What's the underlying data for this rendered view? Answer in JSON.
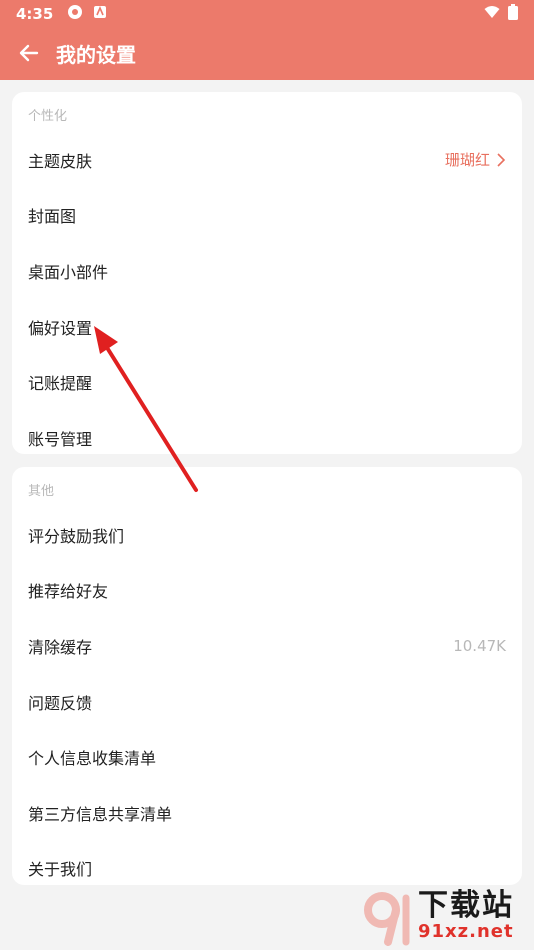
{
  "status_bar": {
    "time": "4:35"
  },
  "header": {
    "title": "我的设置"
  },
  "sections": [
    {
      "title": "个性化",
      "items": [
        {
          "label": "主题皮肤",
          "value": "珊瑚红"
        },
        {
          "label": "封面图"
        },
        {
          "label": "桌面小部件"
        },
        {
          "label": "偏好设置"
        },
        {
          "label": "记账提醒"
        },
        {
          "label": "账号管理"
        }
      ]
    },
    {
      "title": "其他",
      "items": [
        {
          "label": "评分鼓励我们"
        },
        {
          "label": "推荐给好友"
        },
        {
          "label": "清除缓存",
          "value": "10.47K"
        },
        {
          "label": "问题反馈"
        },
        {
          "label": "个人信息收集清单"
        },
        {
          "label": "第三方信息共享清单"
        },
        {
          "label": "关于我们"
        }
      ]
    }
  ],
  "watermark": {
    "main": "下载站",
    "sub": "91xz.net"
  },
  "colors": {
    "header": "#ec7a6b",
    "accent": "#e8705f",
    "annotation_arrow": "#e02020"
  }
}
